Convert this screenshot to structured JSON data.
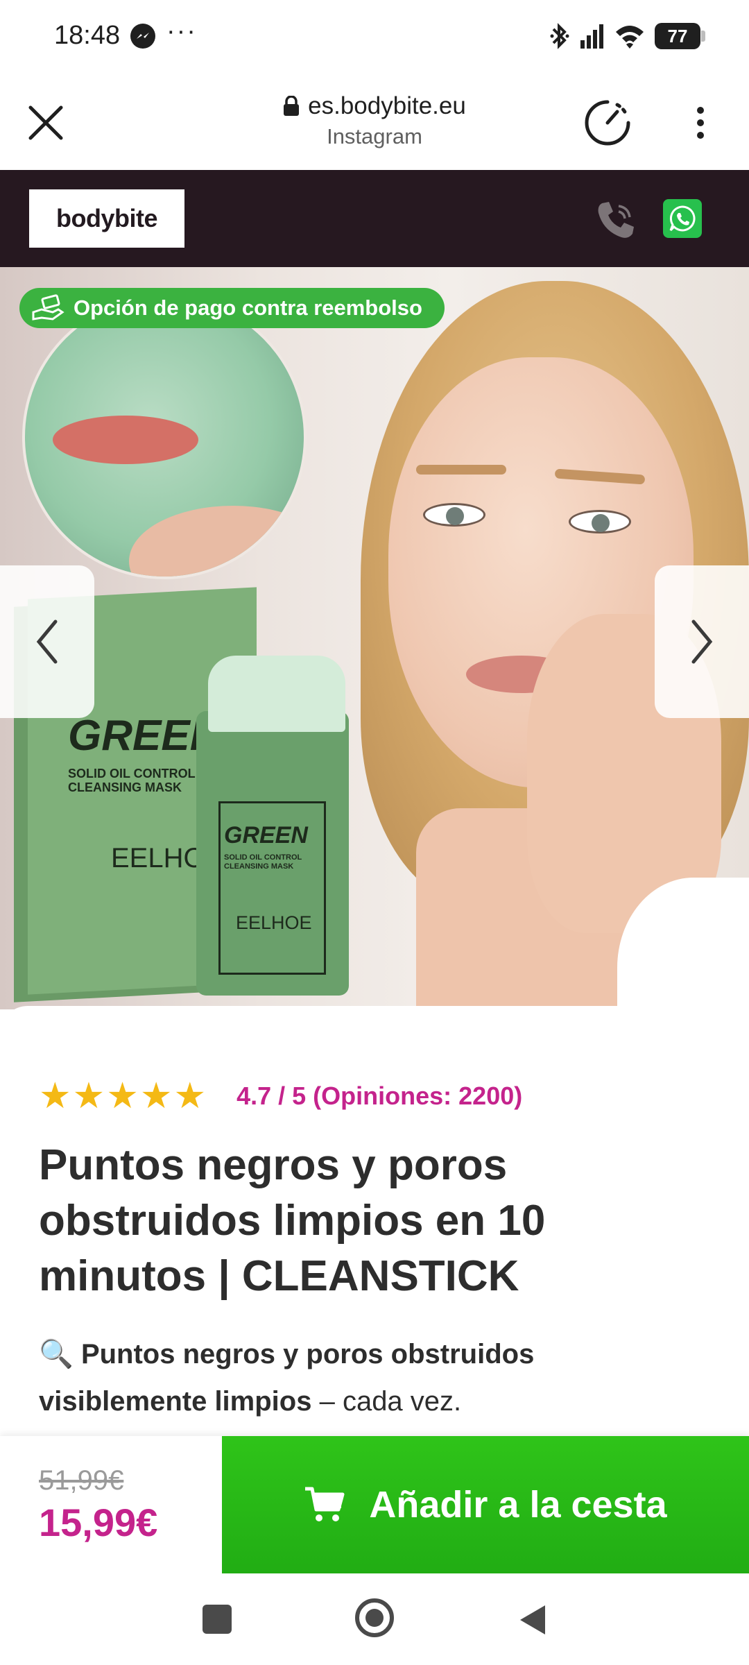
{
  "status_bar": {
    "time": "18:48",
    "overflow": "···",
    "battery": "77",
    "icons": [
      "messenger-icon",
      "bluetooth-icon",
      "signal-icon",
      "wifi-icon",
      "battery-icon"
    ]
  },
  "browser": {
    "domain": "es.bodybite.eu",
    "subtitle": "Instagram",
    "icons": [
      "close-icon",
      "lock-icon",
      "speedometer-icon",
      "more-vert-icon"
    ]
  },
  "site_header": {
    "logo": "bodybite",
    "colors": {
      "background": "#261820",
      "whatsapp": "#27c04d"
    }
  },
  "hero": {
    "badge": "Opción de pago contra reembolso",
    "product_brand": "EELHOE",
    "product_name": "GREEN",
    "product_sub": "SOLID OIL CONTROL CLEANSING MASK",
    "box_brand": "EELHO",
    "box_name": "GREEN"
  },
  "product": {
    "stars": "★★★★★",
    "rating_value": 4.7,
    "rating": "4.7 / 5 (Opiniones: 2200)",
    "title": "Puntos negros y poros obstruidos limpios en 10 minutos | CLEANSTICK",
    "desc_icon": "🔍",
    "desc_bold": "Puntos negros y poros obstruidos visiblemente limpios",
    "desc_rest": " – cada vez."
  },
  "purchase": {
    "old_price": "51,99€",
    "price": "15,99€",
    "cart_label": "Añadir a la cesta",
    "colors": {
      "price": "#c4238c",
      "button": "#27b516"
    }
  },
  "nav": {
    "icons": [
      "recents-icon",
      "home-icon",
      "back-icon"
    ]
  }
}
